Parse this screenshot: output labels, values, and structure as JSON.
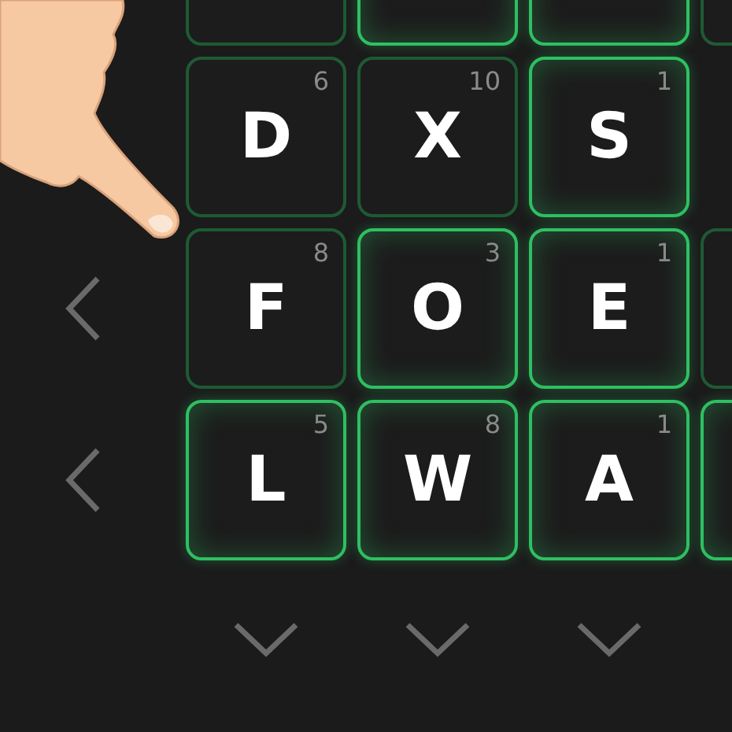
{
  "rows": [
    {
      "left_arrow": false,
      "tiles": [
        {
          "highlighted": false
        },
        {
          "highlighted": true
        },
        {
          "highlighted": true
        },
        {
          "highlighted": false
        }
      ]
    },
    {
      "left_arrow": false,
      "tiles": [
        {
          "letter": "D",
          "points": "6",
          "highlighted": false
        },
        {
          "letter": "X",
          "points": "10",
          "highlighted": false
        },
        {
          "letter": "S",
          "points": "1",
          "highlighted": true
        }
      ]
    },
    {
      "left_arrow": true,
      "tiles": [
        {
          "letter": "F",
          "points": "8",
          "highlighted": false
        },
        {
          "letter": "O",
          "points": "3",
          "highlighted": true
        },
        {
          "letter": "E",
          "points": "1",
          "highlighted": true
        },
        {
          "highlighted": false
        }
      ]
    },
    {
      "left_arrow": true,
      "tiles": [
        {
          "letter": "L",
          "points": "5",
          "highlighted": true
        },
        {
          "letter": "W",
          "points": "8",
          "highlighted": true
        },
        {
          "letter": "A",
          "points": "1",
          "highlighted": true
        },
        {
          "highlighted": true
        }
      ]
    }
  ],
  "column_arrows": [
    {
      "kind": "down"
    },
    {
      "kind": "down"
    },
    {
      "kind": "down"
    }
  ],
  "hint": {
    "kind": "pointing-hand"
  }
}
